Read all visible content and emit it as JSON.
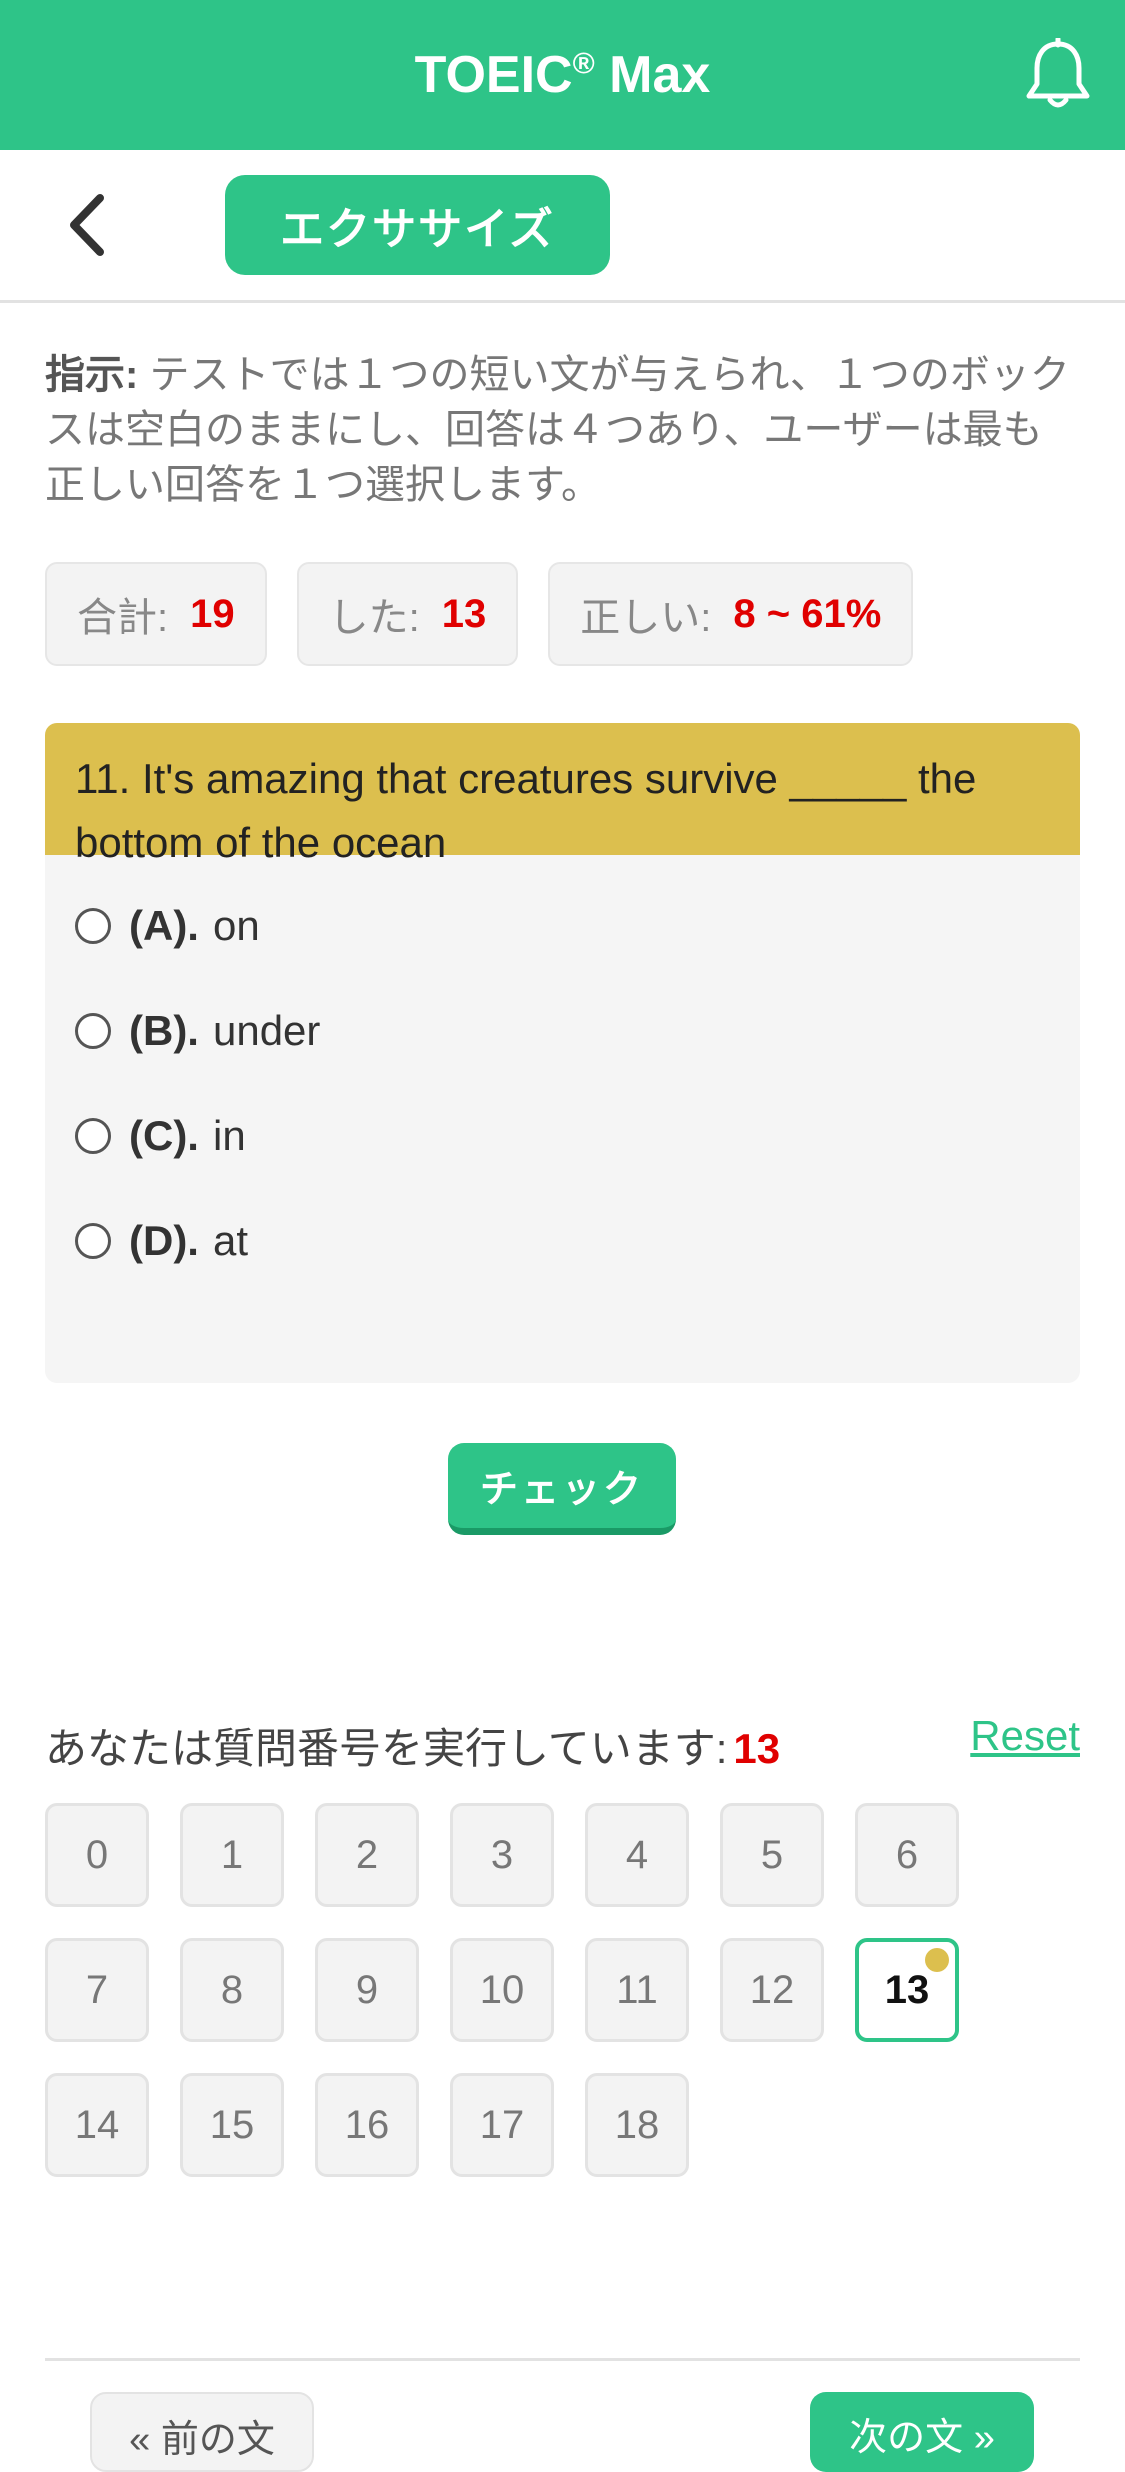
{
  "header": {
    "title": "TOEIC",
    "title_mark": "®",
    "title_suffix": " Max"
  },
  "subnav": {
    "tab_label": "エクササイズ"
  },
  "instruction": {
    "label": "指示:",
    "text": " テストでは１つの短い文が与えられ、１つのボックスは空白のままにし、回答は４つあり、ユーザーは最も正しい回答を１つ選択します。"
  },
  "stats": {
    "total_label": "合計:",
    "total_value": "19",
    "done_label": "した:",
    "done_value": "13",
    "correct_label": "正しい:",
    "correct_value": "8 ~ 61%"
  },
  "question": {
    "text": "11. It's amazing that creatures survive _____ the bottom of the ocean",
    "options": [
      {
        "key": "(A).",
        "text": "on"
      },
      {
        "key": "(B).",
        "text": "under"
      },
      {
        "key": "(C).",
        "text": "in"
      },
      {
        "key": "(D).",
        "text": "at"
      }
    ]
  },
  "check_label": "チェック",
  "progress": {
    "label": "あなたは質問番号を実行しています:",
    "current": "13",
    "reset_label": "Reset"
  },
  "question_numbers": [
    "0",
    "1",
    "2",
    "3",
    "4",
    "5",
    "6",
    "7",
    "8",
    "9",
    "10",
    "11",
    "12",
    "13",
    "14",
    "15",
    "16",
    "17",
    "18"
  ],
  "footer": {
    "prev_label": "« 前の文",
    "next_label": "次の文 »"
  },
  "colors": {
    "brand": "#2ec488",
    "question_header": "#dcbf4e",
    "highlight": "#e00000"
  }
}
